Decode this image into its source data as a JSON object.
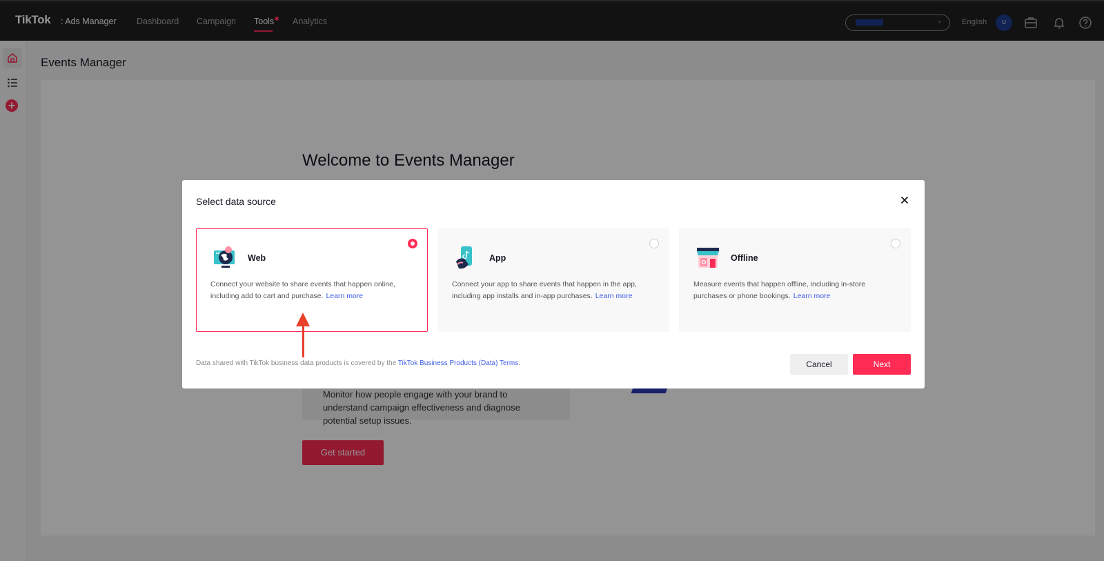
{
  "topnav": {
    "logo": "TikTok",
    "logo_sub": ": Ads Manager",
    "items": [
      {
        "label": "Dashboard"
      },
      {
        "label": "Campaign"
      },
      {
        "label": "Tools"
      },
      {
        "label": "Analytics"
      }
    ],
    "active_item": "Tools",
    "language": "English",
    "avatar_initial": "U",
    "icons": [
      "chevron-down-icon",
      "briefcase-icon",
      "bell-icon",
      "help-icon"
    ]
  },
  "sidebar": {
    "items": [
      {
        "icon": "home-icon",
        "active": true
      },
      {
        "icon": "list-icon",
        "active": false
      },
      {
        "icon": "add-icon",
        "active": false
      }
    ]
  },
  "page": {
    "title": "Events Manager",
    "welcome": "Welcome to Events Manager",
    "monitor_text": "Monitor how people engage with your brand to understand campaign effectiveness and diagnose potential setup issues.",
    "get_started": "Get started"
  },
  "modal": {
    "title": "Select data source",
    "close_icon": "close-icon",
    "cards": [
      {
        "title": "Web",
        "desc": "Connect your website to share events that happen online, including add to cart and purchase.",
        "learn_more": "Learn more",
        "icon": "globe-icon",
        "selected": true
      },
      {
        "title": "App",
        "desc": "Connect your app to share events that happen in the app, including app installs and in-app purchases.",
        "learn_more": "Learn more",
        "icon": "phone-icon",
        "selected": false
      },
      {
        "title": "Offline",
        "desc": "Measure events that happen offline, including in-store purchases or phone bookings.",
        "learn_more": "Learn more",
        "icon": "store-icon",
        "selected": false
      }
    ],
    "footer_text": "Data shared with TikTok business data products is covered by the ",
    "footer_link": "TikTok Business Products (Data) Terms",
    "footer_end": ".",
    "cancel": "Cancel",
    "next": "Next"
  },
  "colors": {
    "accent": "#fe2c55",
    "link": "#3e5ce4",
    "nav_bg": "#1f1f1f",
    "annotation_arrow": "#e8402b"
  }
}
